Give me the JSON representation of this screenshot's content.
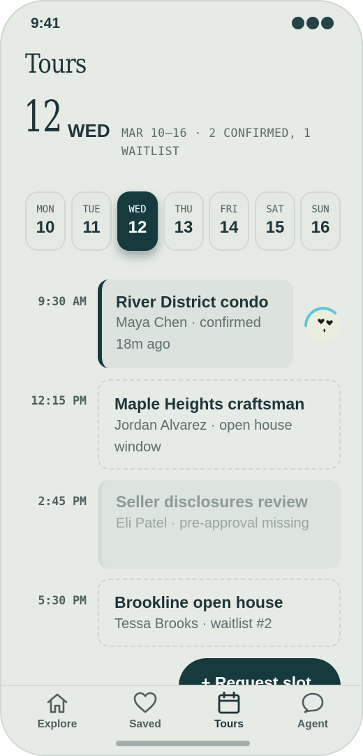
{
  "status": {
    "time": "9:41"
  },
  "page": {
    "title": "Tours"
  },
  "date": {
    "day_num": "12",
    "day_name": "WED",
    "summary": "MAR 10–16 · 2 CONFIRMED, 1 WAITLIST"
  },
  "week": [
    {
      "name": "MON",
      "num": "10"
    },
    {
      "name": "TUE",
      "num": "11"
    },
    {
      "name": "WED",
      "num": "12"
    },
    {
      "name": "THU",
      "num": "13"
    },
    {
      "name": "FRI",
      "num": "14"
    },
    {
      "name": "SAT",
      "num": "15"
    },
    {
      "name": "SUN",
      "num": "16"
    }
  ],
  "selected_day": "WED",
  "slots": [
    {
      "time": "9:30 AM",
      "title": "River District condo",
      "subtitle": "Maya Chen · confirmed 18m ago",
      "state": "confirmed"
    },
    {
      "time": "12:15 PM",
      "title": "Maple Heights craftsman",
      "subtitle": "Jordan Alvarez · open house window",
      "state": "open"
    },
    {
      "time": "2:45 PM",
      "title": "Seller disclosures review",
      "subtitle": "Eli Patel · pre-approval missing",
      "state": "disabled"
    },
    {
      "time": "5:30 PM",
      "title": "Brookline open house",
      "subtitle": "Tessa Brooks · waitlist #2",
      "state": "open"
    }
  ],
  "fab": {
    "label": "+ Request slot"
  },
  "tabs": [
    {
      "label": "Explore",
      "icon": "home-icon"
    },
    {
      "label": "Saved",
      "icon": "heart-icon"
    },
    {
      "label": "Tours",
      "icon": "calendar-icon"
    },
    {
      "label": "Agent",
      "icon": "chat-bubble-icon"
    }
  ],
  "active_tab": "Tours",
  "colors": {
    "accent": "#173a3d",
    "background": "#e6ebe6",
    "text": "#1e3537"
  }
}
